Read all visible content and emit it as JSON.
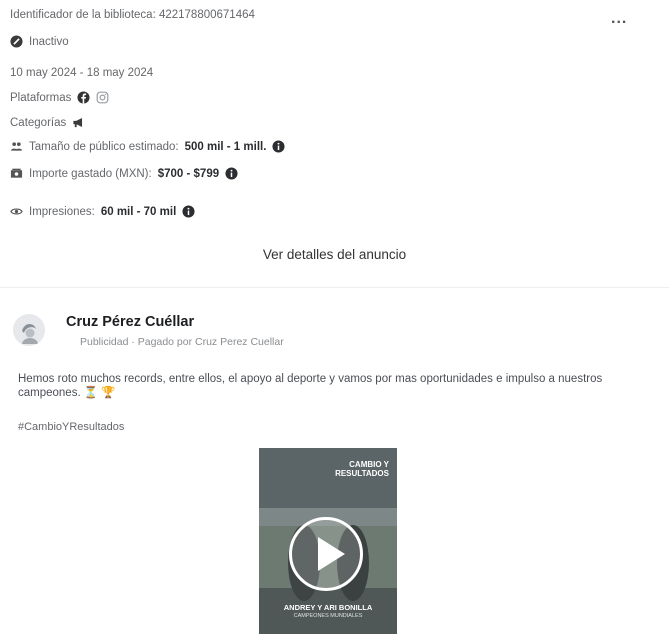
{
  "ad": {
    "library_id": "Identificador de la biblioteca: 422178800671464",
    "more_label": "...",
    "status": "Inactivo",
    "date_range": "10 may 2024 - 18 may 2024",
    "platforms_label": "Plataformas",
    "categories_label": "Categorías",
    "audience_label": "Tamaño de público estimado:",
    "audience_value": "500 mil - 1 mill.",
    "spend_label": "Importe gastado (MXN):",
    "spend_value": "$700 - $799",
    "impressions_label": "Impresiones:",
    "impressions_value": "60 mil - 70 mil",
    "details_link": "Ver detalles del anuncio"
  },
  "post": {
    "advertiser": "Cruz Pérez Cuéllar",
    "sponsored": "Publicidad",
    "separator": " · ",
    "paid_by_label": "Pagado por",
    "paid_by": "Cruz Perez Cuellar",
    "body": "Hemos roto muchos records, entre ellos, el apoyo al deporte y vamos por mas oportunidades e impulso a nuestros campeones.",
    "emojis": "⏳ 🏆",
    "hashtag": "#CambioYResultados",
    "video": {
      "title_line1": "CAMBIO Y",
      "title_line2": "RESULTADOS",
      "caption": "ANDREY Y ARI BONILLA",
      "subcaption": "CAMPEONES MUNDIALES"
    }
  },
  "icons": {
    "status": "inactive-status-icon",
    "facebook": "facebook-icon",
    "instagram": "instagram-icon",
    "category": "megaphone-icon",
    "audience": "people-icon",
    "spend": "money-icon",
    "impressions": "eye-icon",
    "info": "info-icon",
    "play": "play-icon"
  }
}
